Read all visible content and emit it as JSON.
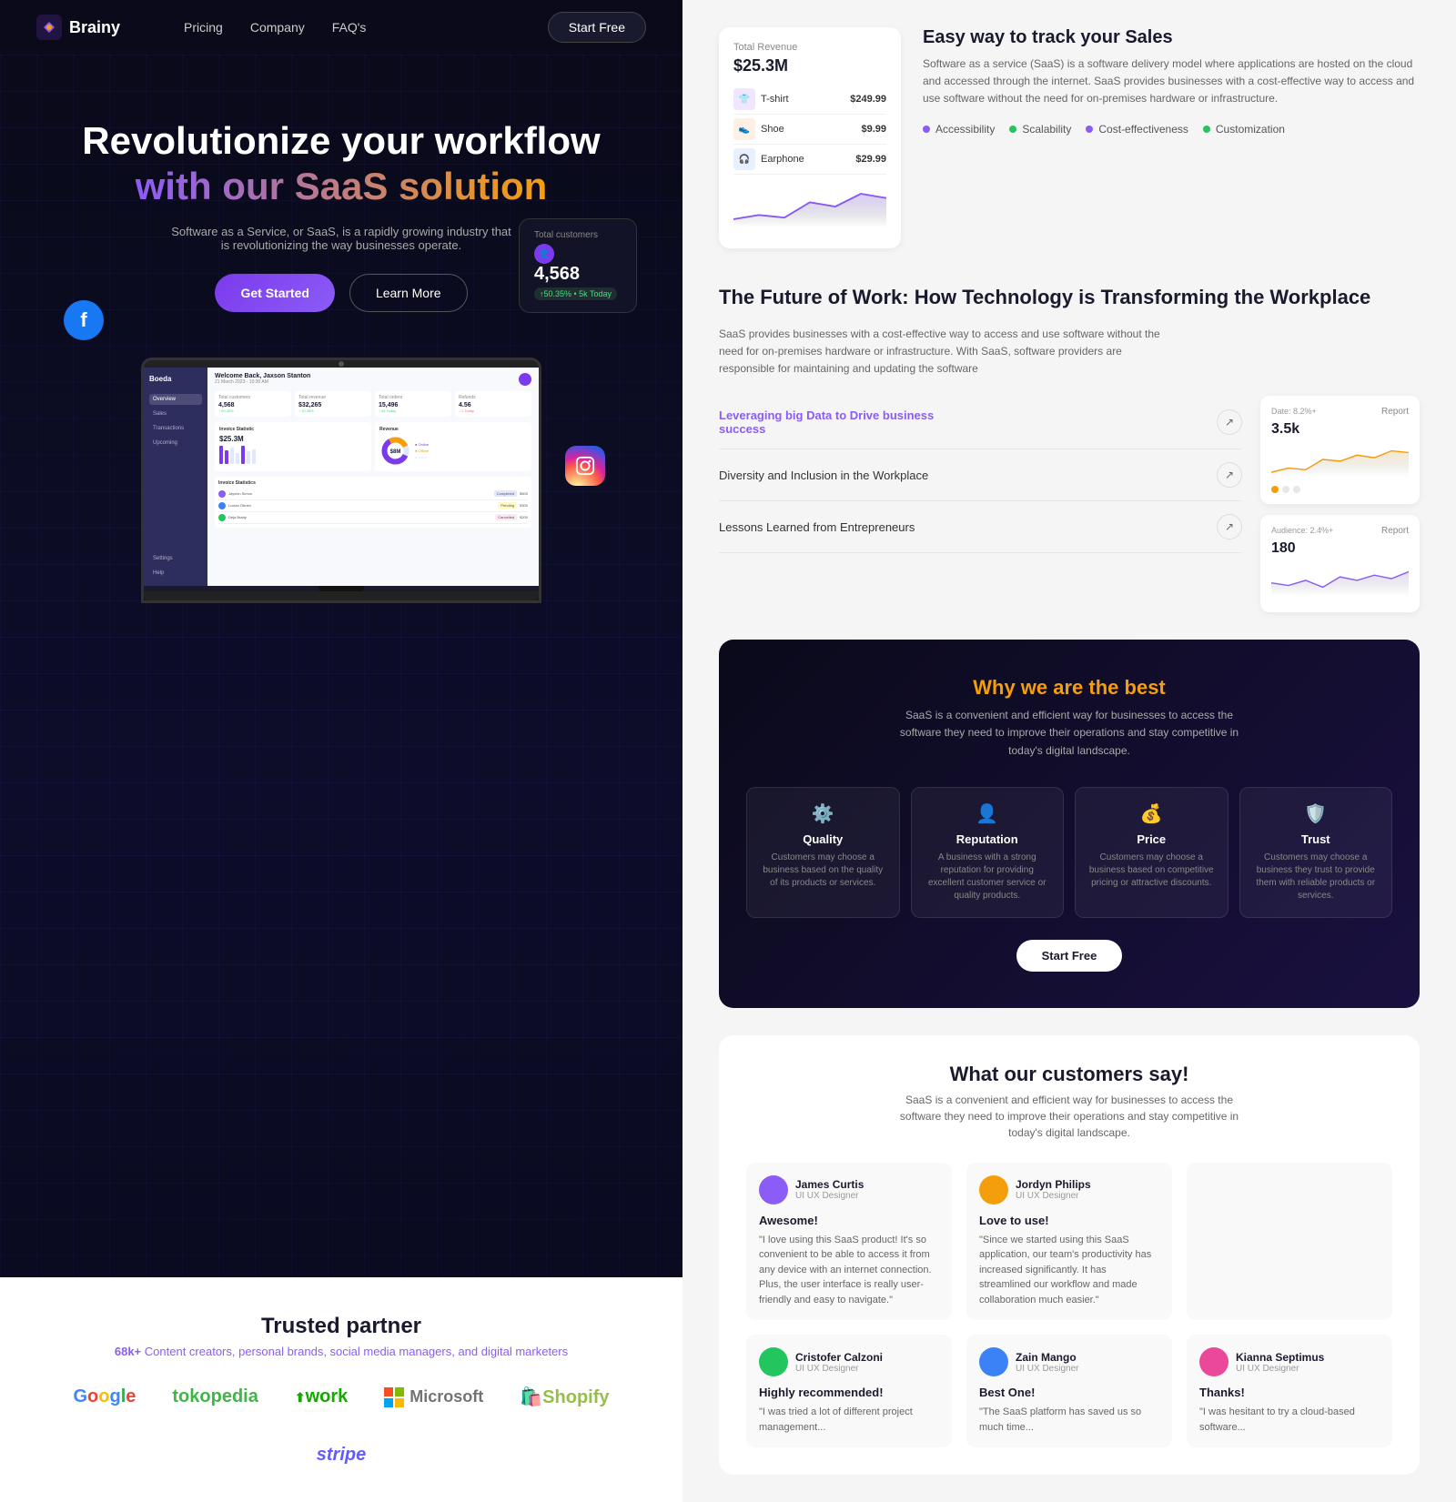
{
  "nav": {
    "logo": "Brainy",
    "links": [
      "Pricing",
      "Company",
      "FAQ's"
    ],
    "cta": "Start Free"
  },
  "hero": {
    "title": "Revolutionize your workflow",
    "subtitle": "with our SaaS solution",
    "description": "Software as a Service, or SaaS, is a rapidly growing industry that is revolutionizing the way businesses operate.",
    "btn_primary": "Get Started",
    "btn_secondary": "Learn More",
    "card_label": "Total customers",
    "card_value": "4,568",
    "card_badge": "↑50.35% • 5k Today"
  },
  "laptop": {
    "welcome": "Welcome Back, Jaxson Stanton",
    "sidebar_items": [
      "Overview",
      "Sales",
      "Transactions",
      "Upcoming",
      "Settings",
      "Help"
    ],
    "stats": [
      {
        "label": "Total customers",
        "value": "4,568"
      },
      {
        "label": "Total revenue",
        "value": "$32,265"
      },
      {
        "label": "Total orders",
        "value": "15,496"
      },
      {
        "label": "Total refunds",
        "value": "4.56"
      }
    ],
    "chart_title": "Invoice Statistic",
    "chart_amount": "$25.3M"
  },
  "trusted": {
    "title": "Trusted partner",
    "subtitle": "68k+ Content creators, personal brands, social media managers, and digital marketers",
    "partners": [
      "Google",
      "tokopedia",
      "Upwork",
      "Microsoft",
      "Shopify",
      "stripe"
    ]
  },
  "easy_way": {
    "chart_amount": "$25.3M",
    "products": [
      {
        "name": "T-shirt",
        "price": "$249.99"
      },
      {
        "name": "Shoe",
        "price": "$9.99"
      },
      {
        "name": "Earphone",
        "price": "$29.99"
      }
    ],
    "title": "Easy way to track your Sales",
    "description": "Software as a service (SaaS) is a software delivery model where applications are hosted on the cloud and accessed through the internet. SaaS provides businesses with a cost-effective way to access and use software without the need for on-premises hardware or infrastructure.",
    "features": [
      "Accessibility",
      "Scalability",
      "Cost-effectiveness",
      "Customization"
    ]
  },
  "future": {
    "title": "The Future of Work: How Technology is Transforming the Workplace",
    "description": "SaaS provides businesses with a cost-effective way to access and use software without the need for on-premises hardware or infrastructure. With SaaS, software providers are responsible for maintaining and updating the software",
    "articles": [
      {
        "title": "Leveraging big Data to Drive business success",
        "featured": true
      },
      {
        "title": "Diversity and Inclusion in the Workplace",
        "featured": false
      },
      {
        "title": "Lessons Learned from Entrepreneurs",
        "featured": false
      }
    ],
    "chart1": {
      "label": "Date: 8.2%+",
      "value": "3.5k",
      "sublabel": "Report"
    },
    "chart2": {
      "label": "Audience: 2.4%+",
      "value": "180",
      "sublabel": "Report"
    }
  },
  "why_best": {
    "title_part1": "Why we are the",
    "title_highlight": "best",
    "description": "SaaS is a convenient and efficient way for businesses to access the software they need to improve their operations and stay competitive in today's digital landscape.",
    "features": [
      {
        "icon": "⚙️",
        "name": "Quality",
        "desc": "Customers may choose a business based on the quality of its products or services."
      },
      {
        "icon": "👤",
        "name": "Reputation",
        "desc": "A business with a strong reputation for providing excellent customer service or quality products."
      },
      {
        "icon": "💰",
        "name": "Price",
        "desc": "Customers may choose a business based on competitive pricing or attractive discounts."
      },
      {
        "icon": "🛡️",
        "name": "Trust",
        "desc": "Customers may choose a business they trust to provide them with reliable products or services."
      }
    ],
    "cta": "Start Free"
  },
  "customers": {
    "title": "What our customers say!",
    "description": "SaaS is a convenient and efficient way for businesses to access the software they need to improve their operations and stay competitive in today's digital landscape.",
    "reviews": [
      {
        "name": "James Curtis",
        "role": "UI UX Designer",
        "title": "Awesome!",
        "text": "\"I love using this SaaS product! It's so convenient to be able to access it from any device with an internet connection. Plus, the user interface is really user-friendly and easy to navigate.\"",
        "avatar_color": "#8b5cf6"
      },
      {
        "name": "Jordyn Philips",
        "role": "UI UX Designer",
        "title": "Love to use!",
        "text": "\"Since we started using this SaaS application, our team's productivity has increased significantly. It has streamlined our workflow and made collaboration much easier.\"",
        "avatar_color": "#f59e0b"
      },
      {
        "name": "Cristofer Calzoni",
        "role": "UI UX Designer",
        "title": "Highly recommended!",
        "text": "\"I was tried a lot of different project management...",
        "avatar_color": "#22c55e"
      },
      {
        "name": "Zain Mango",
        "role": "UI UX Designer",
        "title": "Best One!",
        "text": "\"The SaaS platform has saved us so much time...",
        "avatar_color": "#3b82f6"
      },
      {
        "name": "Kianna Septimus",
        "role": "UI UX Designer",
        "title": "Thanks!",
        "text": "\"I was hesitant to try a cloud-based software...",
        "avatar_color": "#ec4899"
      }
    ]
  }
}
